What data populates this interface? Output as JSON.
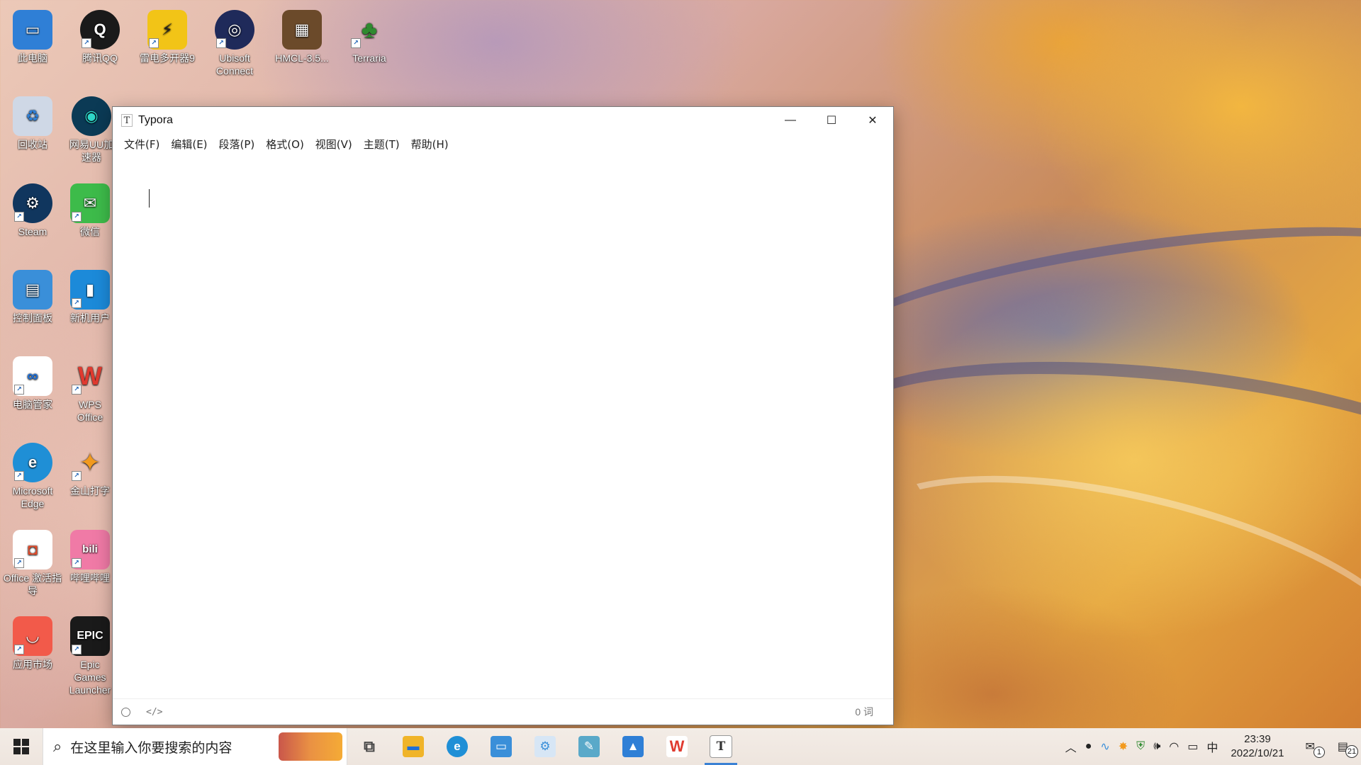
{
  "desktop": {
    "icons": [
      {
        "label": "此电脑",
        "color": "#2f7fd6"
      },
      {
        "label": "腾讯QQ",
        "color": "#1a1a1a"
      },
      {
        "label": "雷电多开器9",
        "color": "#f2c417"
      },
      {
        "label": "Ubisoft Connect",
        "color": "#1f2a5a"
      },
      {
        "label": "HMCL-3.5...",
        "color": "#6b4a2a"
      },
      {
        "label": "Terraria",
        "color": "#2f8a2f"
      },
      {
        "label": "回收站",
        "color": "#cfd8e6"
      },
      {
        "label": "网易UU加速器",
        "color": "#0b3a55"
      },
      {
        "label": "Steam",
        "color": "#10365e"
      },
      {
        "label": "微信",
        "color": "#3dbb4a"
      },
      {
        "label": "控制面板",
        "color": "#3a8fd9"
      },
      {
        "label": "新机用户",
        "color": "#1c8ad9"
      },
      {
        "label": "电脑管家",
        "color": "#ffffff"
      },
      {
        "label": "WPS Office",
        "color": "#e03a2f"
      },
      {
        "label": "Microsoft Edge",
        "color": "#1f8fd6"
      },
      {
        "label": "金山打字",
        "color": "#f29a1e"
      },
      {
        "label": "Office 激活指导",
        "color": "#e04a2a"
      },
      {
        "label": "哔哩哔哩",
        "color": "#f07aa6"
      },
      {
        "label": "应用市场",
        "color": "#f25a4a"
      },
      {
        "label": "Epic Games Launcher",
        "color": "#1a1a1a"
      }
    ]
  },
  "window": {
    "app_icon_glyph": "T",
    "title": "Typora",
    "buttons": {
      "minimize": "—",
      "maximize": "☐",
      "close": "✕"
    },
    "menu": [
      "文件(F)",
      "编辑(E)",
      "段落(P)",
      "格式(O)",
      "视图(V)",
      "主题(T)",
      "帮助(H)"
    ],
    "status": {
      "code_toggle": "</>",
      "word_count": "0 词"
    }
  },
  "taskbar": {
    "search_placeholder": "在这里输入你要搜索的内容",
    "apps": [
      {
        "name": "task-view",
        "glyph": "⧉",
        "color": "#555555"
      },
      {
        "name": "file-explorer",
        "glyph": "▬",
        "color": "#f0b429"
      },
      {
        "name": "edge",
        "glyph": "e",
        "color": "#1f8fd6"
      },
      {
        "name": "this-pc",
        "glyph": "▭",
        "color": "#3a8fd9"
      },
      {
        "name": "settings-tool",
        "glyph": "⚙",
        "color": "#3a8fd9"
      },
      {
        "name": "notes",
        "glyph": "✎",
        "color": "#5aa9c9"
      },
      {
        "name": "paint",
        "glyph": "▲",
        "color": "#2f7fd6"
      },
      {
        "name": "wps",
        "glyph": "W",
        "color": "#e03a2f"
      },
      {
        "name": "typora",
        "glyph": "T",
        "color": "#333333"
      }
    ],
    "tray": {
      "ime": "中",
      "time": "23:39",
      "date": "2022/10/21",
      "notification_count": "21",
      "mail_count": "1"
    }
  }
}
